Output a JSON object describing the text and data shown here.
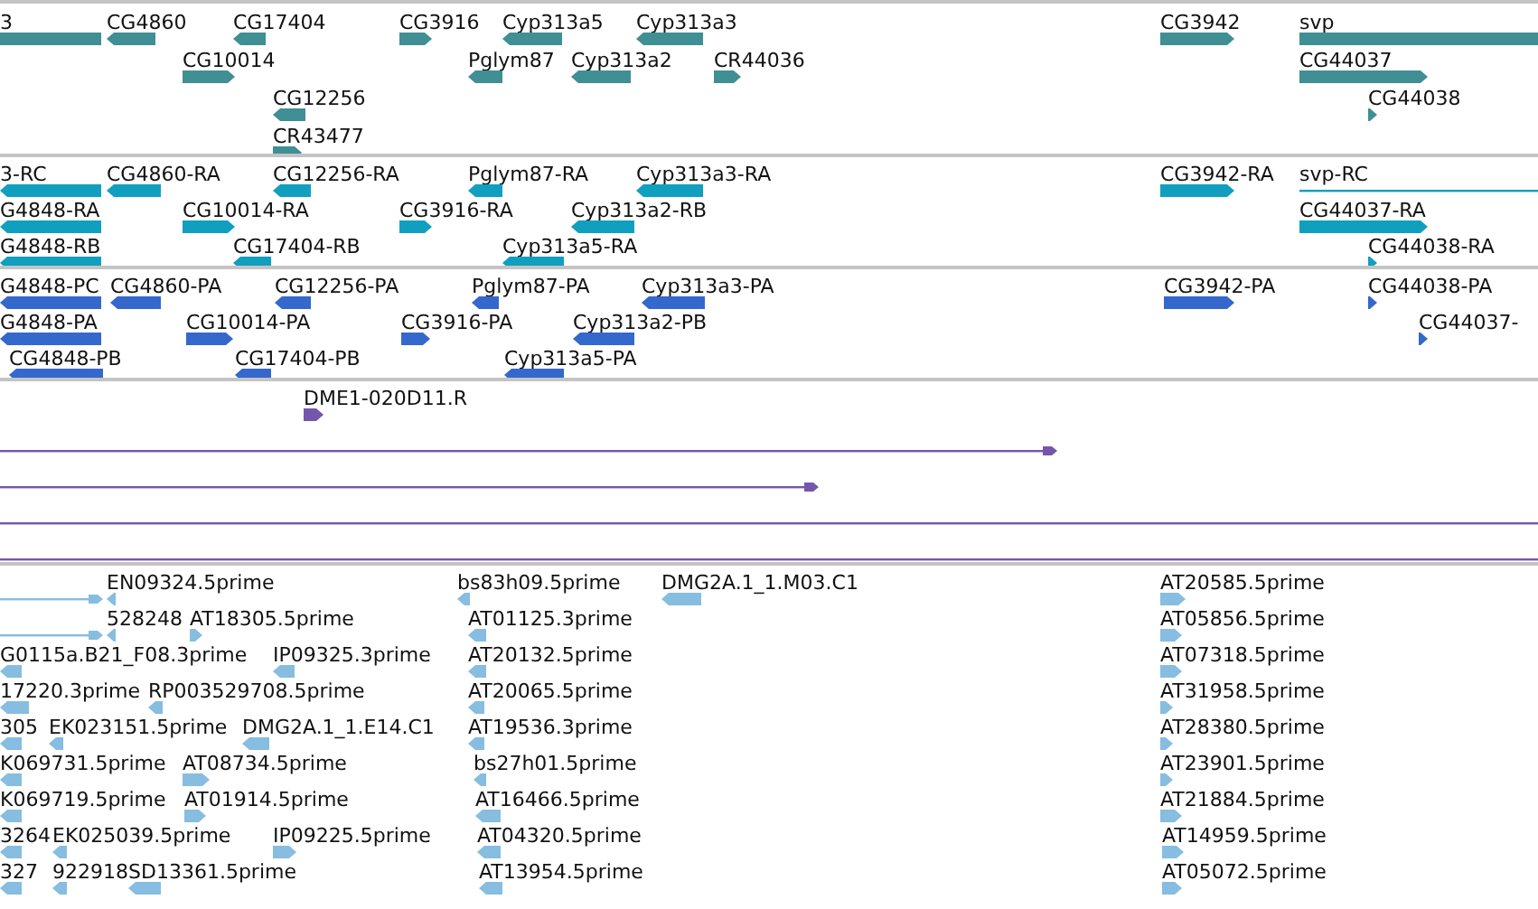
{
  "tracks": [
    {
      "color": "#3f8f94",
      "features": [
        {
          "label": "3",
          "kind": "block"
        },
        {
          "label": "CG4860",
          "kind": "block",
          "reverse": true
        },
        {
          "label": "CG17404",
          "kind": "block",
          "reverse": true
        },
        {
          "label": "CG3916",
          "kind": "block",
          "reverse": false
        },
        {
          "label": "Cyp313a5",
          "kind": "block",
          "reverse": true
        },
        {
          "label": "Cyp313a3",
          "kind": "block",
          "reverse": true
        },
        {
          "label": "CG3942",
          "kind": "block",
          "reverse": false
        },
        {
          "label": "svp",
          "kind": "block"
        },
        {
          "label": "CG10014",
          "kind": "block",
          "reverse": false
        },
        {
          "label": "Pglym87",
          "kind": "block",
          "reverse": true
        },
        {
          "label": "Cyp313a2",
          "kind": "block",
          "reverse": true
        },
        {
          "label": "CR44036",
          "kind": "block",
          "reverse": false
        },
        {
          "label": "CG44037",
          "kind": "block",
          "reverse": false
        },
        {
          "label": "CG12256",
          "kind": "block",
          "reverse": true
        },
        {
          "label": "CG44038",
          "kind": "block",
          "reverse": false
        },
        {
          "label": "CR43477",
          "kind": "block",
          "reverse": false
        }
      ]
    },
    {
      "color": "#119fc0",
      "features": [
        {
          "label": "3-RC",
          "kind": "block",
          "reverse": true
        },
        {
          "label": "CG4860-RA",
          "kind": "block",
          "reverse": true
        },
        {
          "label": "CG12256-RA",
          "kind": "block",
          "reverse": true
        },
        {
          "label": "Pglym87-RA",
          "kind": "block",
          "reverse": true
        },
        {
          "label": "Cyp313a3-RA",
          "kind": "block",
          "reverse": true
        },
        {
          "label": "CG3942-RA",
          "kind": "block",
          "reverse": false
        },
        {
          "label": "svp-RC",
          "kind": "line"
        },
        {
          "label": "G4848-RA",
          "kind": "block",
          "reverse": true
        },
        {
          "label": "CG10014-RA",
          "kind": "block",
          "reverse": false
        },
        {
          "label": "CG3916-RA",
          "kind": "block",
          "reverse": false
        },
        {
          "label": "Cyp313a2-RB",
          "kind": "block",
          "reverse": true
        },
        {
          "label": "CG44037-RA",
          "kind": "block",
          "reverse": false
        },
        {
          "label": "G4848-RB",
          "kind": "block",
          "reverse": true
        },
        {
          "label": "CG17404-RB",
          "kind": "block",
          "reverse": true
        },
        {
          "label": "Cyp313a5-RA",
          "kind": "block",
          "reverse": true
        },
        {
          "label": "CG44038-RA",
          "kind": "block",
          "reverse": false
        }
      ]
    },
    {
      "color": "#3468cc",
      "features": [
        {
          "label": "G4848-PC",
          "kind": "block",
          "reverse": true
        },
        {
          "label": "CG4860-PA",
          "kind": "block",
          "reverse": true
        },
        {
          "label": "CG12256-PA",
          "kind": "block",
          "reverse": true
        },
        {
          "label": "Pglym87-PA",
          "kind": "block",
          "reverse": true
        },
        {
          "label": "Cyp313a3-PA",
          "kind": "block",
          "reverse": true
        },
        {
          "label": "CG3942-PA",
          "kind": "block",
          "reverse": false
        },
        {
          "label": "CG44038-PA",
          "kind": "block",
          "reverse": false
        },
        {
          "label": "G4848-PA",
          "kind": "block",
          "reverse": true
        },
        {
          "label": "CG10014-PA",
          "kind": "block",
          "reverse": false
        },
        {
          "label": "CG3916-PA",
          "kind": "block",
          "reverse": false
        },
        {
          "label": "Cyp313a2-PB",
          "kind": "block",
          "reverse": true
        },
        {
          "label": "CG44037-",
          "kind": "block",
          "reverse": false
        },
        {
          "label": "CG4848-PB",
          "kind": "block",
          "reverse": true
        },
        {
          "label": "CG17404-PB",
          "kind": "block",
          "reverse": true
        },
        {
          "label": "Cyp313a5-PA",
          "kind": "block",
          "reverse": true
        }
      ]
    },
    {
      "color": "#7656ab",
      "features": [
        {
          "label": "DME1-020D11.R",
          "kind": "block",
          "reverse": false
        },
        {
          "kind": "line",
          "reverse": false
        },
        {
          "kind": "line",
          "reverse": false
        },
        {
          "kind": "line"
        },
        {
          "kind": "line"
        }
      ]
    },
    {
      "color": "#87bde0",
      "features": [
        {
          "kind": "line",
          "reverse": false
        },
        {
          "label": "EN09324.5prime",
          "kind": "block",
          "reverse": true
        },
        {
          "label": "bs83h09.5prime",
          "kind": "block",
          "reverse": true
        },
        {
          "label": "DMG2A.1_1.M03.C1",
          "kind": "block",
          "reverse": true
        },
        {
          "label": "AT20585.5prime",
          "kind": "block",
          "reverse": false
        },
        {
          "kind": "line",
          "reverse": false
        },
        {
          "label": "528248",
          "kind": "block",
          "reverse": true
        },
        {
          "label": "AT18305.5prime",
          "kind": "block",
          "reverse": false
        },
        {
          "label": "AT01125.3prime",
          "kind": "block",
          "reverse": true
        },
        {
          "label": "AT05856.5prime",
          "kind": "block",
          "reverse": false
        },
        {
          "label": "G0115a.B21_F08.3prime",
          "kind": "block",
          "reverse": true
        },
        {
          "label": "IP09325.3prime",
          "kind": "block",
          "reverse": true
        },
        {
          "label": "AT20132.5prime",
          "kind": "block",
          "reverse": true
        },
        {
          "label": "AT07318.5prime",
          "kind": "block",
          "reverse": false
        },
        {
          "label": "17220.3prime",
          "kind": "block",
          "reverse": true
        },
        {
          "label": "RP003529708.5prime",
          "kind": "block",
          "reverse": true
        },
        {
          "label": "AT20065.5prime",
          "kind": "block",
          "reverse": true
        },
        {
          "label": "AT31958.5prime",
          "kind": "block",
          "reverse": false
        },
        {
          "label": "305",
          "kind": "block",
          "reverse": true
        },
        {
          "label": "EK023151.5prime",
          "kind": "block",
          "reverse": true
        },
        {
          "label": "DMG2A.1_1.E14.C1",
          "kind": "block",
          "reverse": true
        },
        {
          "label": "AT19536.3prime",
          "kind": "block",
          "reverse": true
        },
        {
          "label": "AT28380.5prime",
          "kind": "block",
          "reverse": false
        },
        {
          "label": "K069731.5prime",
          "kind": "block",
          "reverse": true
        },
        {
          "label": "AT08734.5prime",
          "kind": "block",
          "reverse": false
        },
        {
          "label": "bs27h01.5prime",
          "kind": "block",
          "reverse": true
        },
        {
          "label": "AT23901.5prime",
          "kind": "block",
          "reverse": false
        },
        {
          "label": "K069719.5prime",
          "kind": "block",
          "reverse": true
        },
        {
          "label": "AT01914.5prime",
          "kind": "block",
          "reverse": false
        },
        {
          "label": "AT16466.5prime",
          "kind": "block",
          "reverse": true
        },
        {
          "label": "AT21884.5prime",
          "kind": "block",
          "reverse": false
        },
        {
          "label": "3264",
          "kind": "block",
          "reverse": true
        },
        {
          "label": "EK025039.5prime",
          "kind": "block",
          "reverse": true
        },
        {
          "label": "IP09225.5prime",
          "kind": "block",
          "reverse": false
        },
        {
          "label": "AT04320.5prime",
          "kind": "block",
          "reverse": true
        },
        {
          "label": "AT14959.5prime",
          "kind": "block",
          "reverse": false
        },
        {
          "label": "327",
          "kind": "block",
          "reverse": true
        },
        {
          "label": "922918",
          "kind": "block",
          "reverse": true
        },
        {
          "label": "SD13361.5prime",
          "kind": "block",
          "reverse": true
        },
        {
          "label": "AT13954.5prime",
          "kind": "block",
          "reverse": true
        },
        {
          "label": "AT05072.5prime",
          "kind": "block",
          "reverse": false
        }
      ]
    }
  ]
}
